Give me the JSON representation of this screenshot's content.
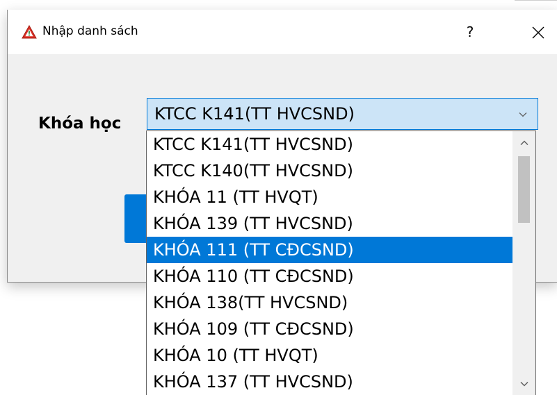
{
  "dialog": {
    "title": "Nhập danh sách",
    "help_label": "?",
    "title_icon": "warning-triangle-icon",
    "close_icon": "close-icon"
  },
  "form": {
    "course_label": "Khóa học",
    "course_selected": "KTCC K141(TT HVCSND)"
  },
  "dropdown": {
    "items": [
      "KTCC K141(TT HVCSND)",
      "KTCC K140(TT HVCSND)",
      "KHÓA 11 (TT HVQT)",
      "KHÓA 139 (TT HVCSND)",
      "KHÓA 111 (TT CĐCSND)",
      "KHÓA 110 (TT CĐCSND)",
      "KHÓA 138(TT HVCSND)",
      "KHÓA 109 (TT CĐCSND)",
      "KHÓA 10 (TT HVQT)",
      "KHÓA 137 (TT HVCSND)"
    ],
    "highlighted_index": 4
  },
  "colors": {
    "accent": "#0078d7",
    "combo_bg": "#cce4f7",
    "dialog_bg": "#f0f0f0"
  }
}
